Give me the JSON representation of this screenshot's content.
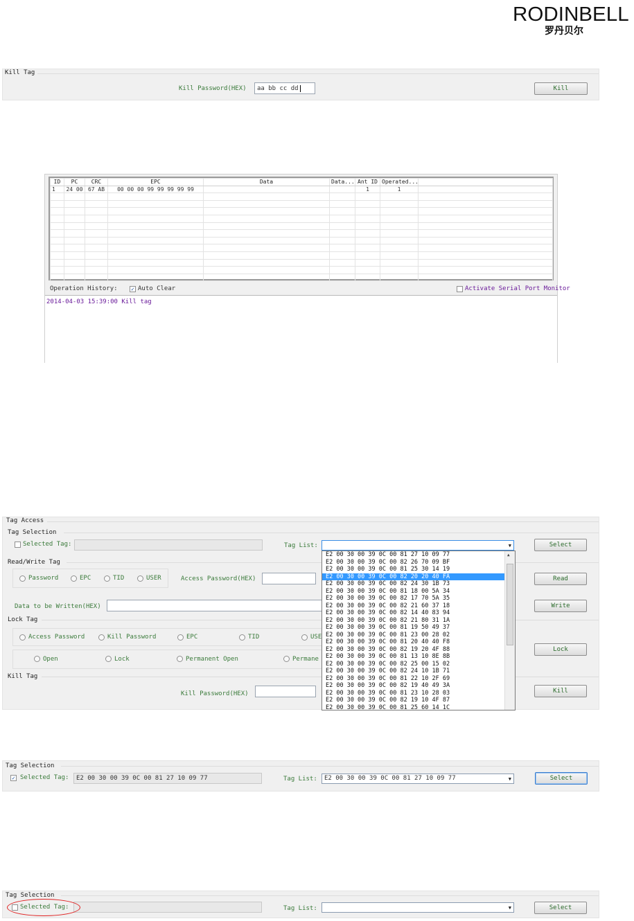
{
  "logo": {
    "brand": "RODINBELL",
    "chinese": "罗丹贝尔"
  },
  "kill_tag_panel": {
    "title": "Kill Tag",
    "password_label": "Kill Password(HEX)",
    "password_value": "aa bb cc dd",
    "kill_button": "Kill"
  },
  "results": {
    "columns": [
      "ID",
      "PC",
      "CRC",
      "EPC",
      "Data",
      "Data...",
      "Ant ID",
      "Operated..."
    ],
    "rows": [
      [
        "1",
        "24 00",
        "67 AB",
        "00 00 00 99 99 99 99 99",
        "",
        "",
        "1",
        "1"
      ]
    ],
    "history_label": "Operation History:",
    "auto_clear_label": "Auto Clear",
    "auto_clear_checked": true,
    "serial_monitor_label": "Activate Serial Port Monitor",
    "log_entry": "2014-04-03 15:39:00 Kill tag"
  },
  "tag_access": {
    "title": "Tag Access",
    "selection_title": "Tag Selection",
    "selected_tag_label": "Selected Tag:",
    "tag_list_label": "Tag List:",
    "select_button": "Select",
    "rw_title": "Read/Write Tag",
    "mem_options": [
      "Password",
      "EPC",
      "TID",
      "USER"
    ],
    "access_password_label": "Access Password(HEX)",
    "read_button": "Read",
    "data_label": "Data to be Written(HEX)",
    "write_button": "Write",
    "lock_title": "Lock Tag",
    "lock_targets": [
      "Access Password",
      "Kill Password",
      "EPC",
      "TID",
      "USE"
    ],
    "lock_types": [
      "Open",
      "Lock",
      "Permanent Open",
      "Permane"
    ],
    "lock_button": "Lock",
    "kill_title": "Kill Tag",
    "kill_password_label": "Kill Password(HEX)",
    "kill_button": "Kill",
    "tag_list_items": [
      "E2 00 30 00 39 0C 00 81 27 10 09 77",
      "E2 00 30 00 39 0C 00 82 26 70 09 BF",
      "E2 00 30 00 39 0C 00 81 25 30 14 19",
      "E2 00 30 00 39 0C 00 82 20 20 40 FA",
      "E2 00 30 00 39 0C 00 82 24 30 1B 73",
      "E2 00 30 00 39 0C 00 81 18 00 5A 34",
      "E2 00 30 00 39 0C 00 82 17 70 5A 35",
      "E2 00 30 00 39 0C 00 82 21 60 37 18",
      "E2 00 30 00 39 0C 00 82 14 40 83 94",
      "E2 00 30 00 39 0C 00 82 21 80 31 1A",
      "E2 00 30 00 39 0C 00 81 19 50 49 37",
      "E2 00 30 00 39 0C 00 81 23 00 28 02",
      "E2 00 30 00 39 0C 00 81 20 40 40 F8",
      "E2 00 30 00 39 0C 00 82 19 20 4F 88",
      "E2 00 30 00 39 0C 00 81 13 10 8E 8B",
      "E2 00 30 00 39 0C 00 82 25 00 15 02",
      "E2 00 30 00 39 0C 00 82 24 10 1B 71",
      "E2 00 30 00 39 0C 00 81 22 10 2F 69",
      "E2 00 30 00 39 0C 00 82 19 40 49 3A",
      "E2 00 30 00 39 0C 00 81 23 10 28 03",
      "E2 00 30 00 39 0C 00 82 19 10 4F 87",
      "E2 00 30 00 39 0C 00 81 25 60 14 1C"
    ],
    "tag_list_selected_index": 3
  },
  "selection_checked": {
    "title": "Tag Selection",
    "selected_tag_label": "Selected Tag:",
    "selected_tag_value": "E2 00 30 00 39 0C 00 81 27 10 09 77",
    "checked": true,
    "tag_list_label": "Tag List:",
    "tag_list_value": "E2 00 30 00 39 0C 00 81 27 10 09 77",
    "select_button": "Select"
  },
  "selection_unchecked": {
    "title": "Tag Selection",
    "selected_tag_label": "Selected Tag:",
    "checked": false,
    "tag_list_label": "Tag List:",
    "tag_list_value": "",
    "select_button": "Select"
  },
  "colors": {
    "accent_green": "#3a7a3a",
    "log_purple": "#6a1b9a",
    "highlight_blue": "#3399ff",
    "annotation_red": "#e02020"
  }
}
